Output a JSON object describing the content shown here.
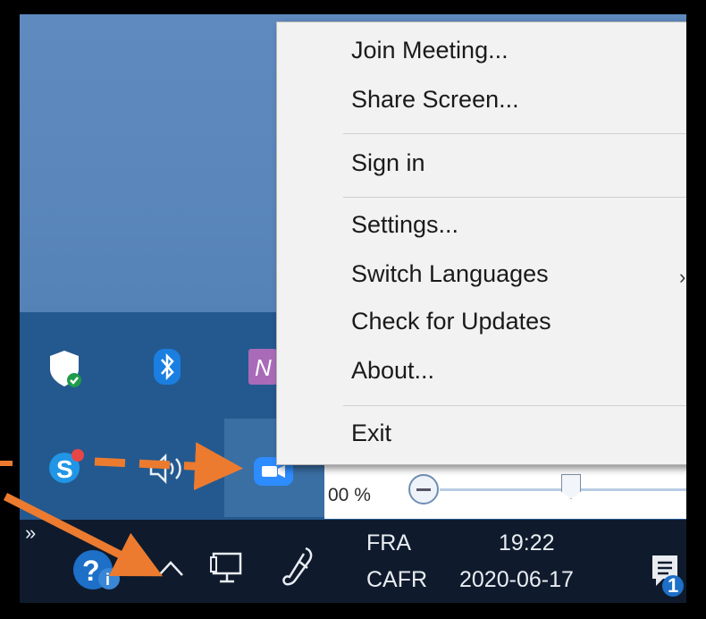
{
  "context_menu": {
    "items": [
      {
        "label": "Join Meeting..."
      },
      {
        "label": "Share Screen..."
      },
      {
        "label": "Sign in"
      },
      {
        "label": "Settings..."
      },
      {
        "label": "Switch Languages",
        "has_submenu": true
      },
      {
        "label": "Check for Updates"
      },
      {
        "label": "About..."
      },
      {
        "label": "Exit"
      }
    ],
    "submenu_glyph": "›"
  },
  "zoom_control": {
    "value_text": "00 %"
  },
  "taskbar": {
    "language_code": "FRA",
    "keyboard_layout": "CAFR",
    "time": "19:22",
    "date": "2020-06-17",
    "overflow_glyph": "»",
    "notification_count": "1"
  },
  "tray_icons": {
    "row1": [
      "shield-icon",
      "bluetooth-icon",
      "onenote-icon"
    ],
    "row2": [
      "skype-icon",
      "speaker-icon",
      "zoom-icon"
    ],
    "taskbar": [
      "help-icon",
      "chevron-up-icon",
      "network-icon",
      "pen-icon",
      "notification-icon"
    ]
  },
  "colors": {
    "annotation_arrow": "#ec7b2f",
    "flyout_background": "#24598f",
    "taskbar_background": "#0f1b2d",
    "menu_background": "#f2f2f2"
  }
}
